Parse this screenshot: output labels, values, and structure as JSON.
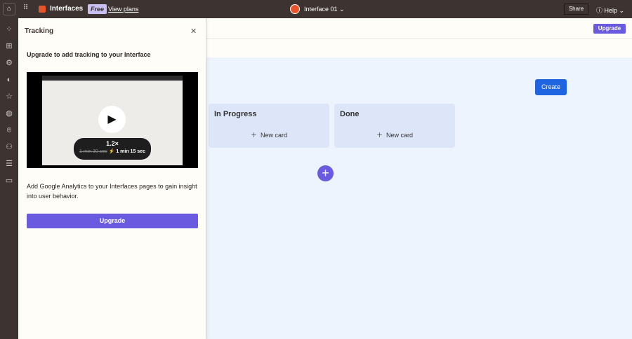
{
  "topbar": {
    "app_name": "Interfaces",
    "plan_badge": "Free",
    "view_plans": "View plans",
    "interface_name": "Interface 01",
    "share": "Share",
    "help": "Help"
  },
  "banner": {
    "upgrade": "Upgrade"
  },
  "panel": {
    "title": "Tracking",
    "heading": "Upgrade to add tracking to your Interface",
    "video": {
      "speed": "1.2×",
      "old_time": "1 min 30 sec",
      "new_time": "1 min 15 sec"
    },
    "description": "Add Google Analytics to your Interfaces pages to gain insight into user behavior.",
    "upgrade": "Upgrade"
  },
  "main": {
    "create": "Create",
    "columns": [
      {
        "title": "In Progress",
        "new_card": "New card"
      },
      {
        "title": "Done",
        "new_card": "New card"
      }
    ]
  },
  "colors": {
    "accent": "#6a5ae0",
    "create": "#1f64e0",
    "dark": "#3d3330"
  }
}
